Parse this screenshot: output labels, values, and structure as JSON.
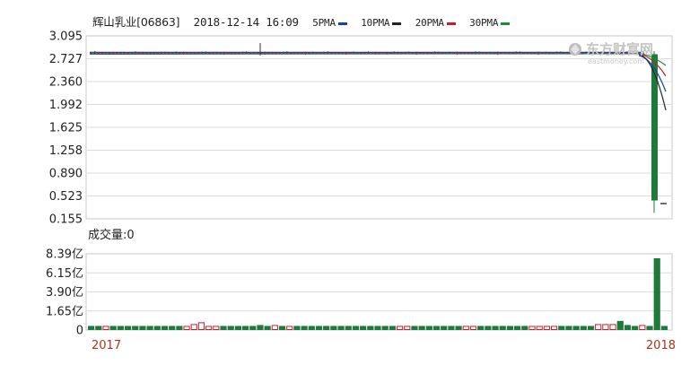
{
  "header": {
    "stock": "辉山乳业[06863]",
    "datetime": "2018-12-14 16:09",
    "ma": [
      {
        "label": "5PMA",
        "color": "#1a3fb0"
      },
      {
        "label": "10PMA",
        "color": "#222222"
      },
      {
        "label": "20PMA",
        "color": "#c0202a"
      },
      {
        "label": "30PMA",
        "color": "#1e8a3c"
      }
    ]
  },
  "watermark": {
    "brand": "东方财富网",
    "sub": "eastmoney.com"
  },
  "volume_label": "成交量:0",
  "chart_data": [
    {
      "type": "candlestick",
      "title": "",
      "y_ticks": [
        "3.095",
        "2.727",
        "2.360",
        "1.992",
        "1.625",
        "1.258",
        "0.890",
        "0.523",
        "0.155"
      ],
      "ylim": [
        0.155,
        3.095
      ],
      "grid": true,
      "price_level": 2.82,
      "final_drop": {
        "open": 2.8,
        "close": 0.45,
        "high": 2.85,
        "low": 0.25
      },
      "last_price": 0.4,
      "ma_tails": [
        {
          "name": "5PMA",
          "from": 2.78,
          "to": 2.2
        },
        {
          "name": "10PMA",
          "from": 2.8,
          "to": 1.9
        },
        {
          "name": "20PMA",
          "from": 2.81,
          "to": 2.45
        },
        {
          "name": "30PMA",
          "from": 2.82,
          "to": 2.62
        }
      ]
    },
    {
      "type": "bar",
      "title": "",
      "y_ticks": [
        "8.39亿",
        "6.15亿",
        "3.90亿",
        "1.65亿",
        "0"
      ],
      "ylim": [
        0,
        8.39
      ],
      "unit": "亿",
      "x_labels": [
        "2017",
        "2018"
      ],
      "grid": true,
      "volumes": [
        0.45,
        0.45,
        0.45,
        0.45,
        0.45,
        0.45,
        0.45,
        0.45,
        0.45,
        0.45,
        0.45,
        0.45,
        0.45,
        0.45,
        0.65,
        0.85,
        0.45,
        0.45,
        0.45,
        0.45,
        0.45,
        0.45,
        0.45,
        0.55,
        0.45,
        0.55,
        0.45,
        0.45,
        0.45,
        0.45,
        0.45,
        0.45,
        0.45,
        0.45,
        0.45,
        0.45,
        0.45,
        0.45,
        0.45,
        0.45,
        0.45,
        0.45,
        0.45,
        0.45,
        0.45,
        0.45,
        0.45,
        0.45,
        0.45,
        0.45,
        0.45,
        0.45,
        0.45,
        0.45,
        0.45,
        0.45,
        0.45,
        0.45,
        0.45,
        0.45,
        0.45,
        0.45,
        0.45,
        0.45,
        0.45,
        0.45,
        0.45,
        0.45,
        0.45,
        0.65,
        0.65,
        0.65,
        1.0,
        0.55,
        0.45,
        0.55,
        0.45,
        7.9,
        0.45
      ],
      "volume_up": [
        0,
        0,
        1,
        0,
        0,
        0,
        0,
        0,
        0,
        0,
        0,
        0,
        0,
        1,
        1,
        1,
        1,
        1,
        0,
        0,
        0,
        0,
        0,
        0,
        0,
        1,
        0,
        1,
        0,
        0,
        0,
        0,
        0,
        0,
        0,
        0,
        0,
        0,
        0,
        0,
        0,
        0,
        1,
        1,
        0,
        0,
        0,
        0,
        0,
        0,
        0,
        1,
        1,
        0,
        0,
        0,
        0,
        0,
        0,
        0,
        1,
        1,
        1,
        1,
        0,
        0,
        0,
        0,
        0,
        1,
        1,
        1,
        0,
        0,
        0,
        1,
        0,
        0,
        0
      ]
    }
  ]
}
